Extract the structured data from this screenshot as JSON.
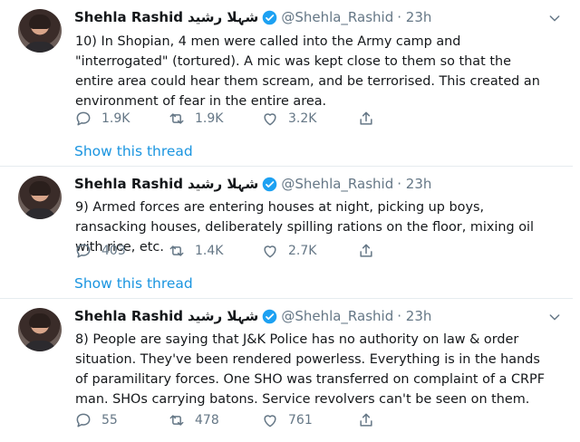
{
  "tweets": [
    {
      "name": "Shehla Rashid",
      "urdu_name": "شہلا رشید",
      "handle": "@Shehla_Rashid",
      "time": "· 23h",
      "text": "10) In Shopian, 4 men were called into the Army camp and \"interrogated\" (tortured). A mic was kept close to them so that the entire area could hear them scream, and be terrorised. This created an environment of fear in the entire area.",
      "replies": "1.9K",
      "retweets": "1.9K",
      "likes": "3.2K",
      "show_thread": "Show this thread"
    },
    {
      "name": "Shehla Rashid",
      "urdu_name": "شہلا رشید",
      "handle": "@Shehla_Rashid",
      "time": "· 23h",
      "text": "9) Armed forces are entering houses at night, picking up boys, ransacking houses, deliberately spilling rations on the floor, mixing oil with rice, etc.",
      "replies": "403",
      "retweets": "1.4K",
      "likes": "2.7K",
      "show_thread": "Show this thread"
    },
    {
      "name": "Shehla Rashid",
      "urdu_name": "شہلا رشید",
      "handle": "@Shehla_Rashid",
      "time": "· 23h",
      "text": "8) People are saying that J&K Police has no authority on law & order situation. They've been rendered powerless. Everything is in the hands of paramilitary forces. One SHO was transferred on complaint of a CRPF man. SHOs carrying batons. Service revolvers can't be seen on them.",
      "replies": "55",
      "retweets": "478",
      "likes": "761"
    }
  ],
  "colors": {
    "link": "#1b95e0",
    "muted": "#657786",
    "verified": "#1da1f2",
    "text": "#14171a",
    "divider": "#e6ecf0"
  },
  "icons": [
    "avatar",
    "verified-badge-icon",
    "chevron-down-icon",
    "reply-icon",
    "retweet-icon",
    "like-icon",
    "share-icon"
  ]
}
